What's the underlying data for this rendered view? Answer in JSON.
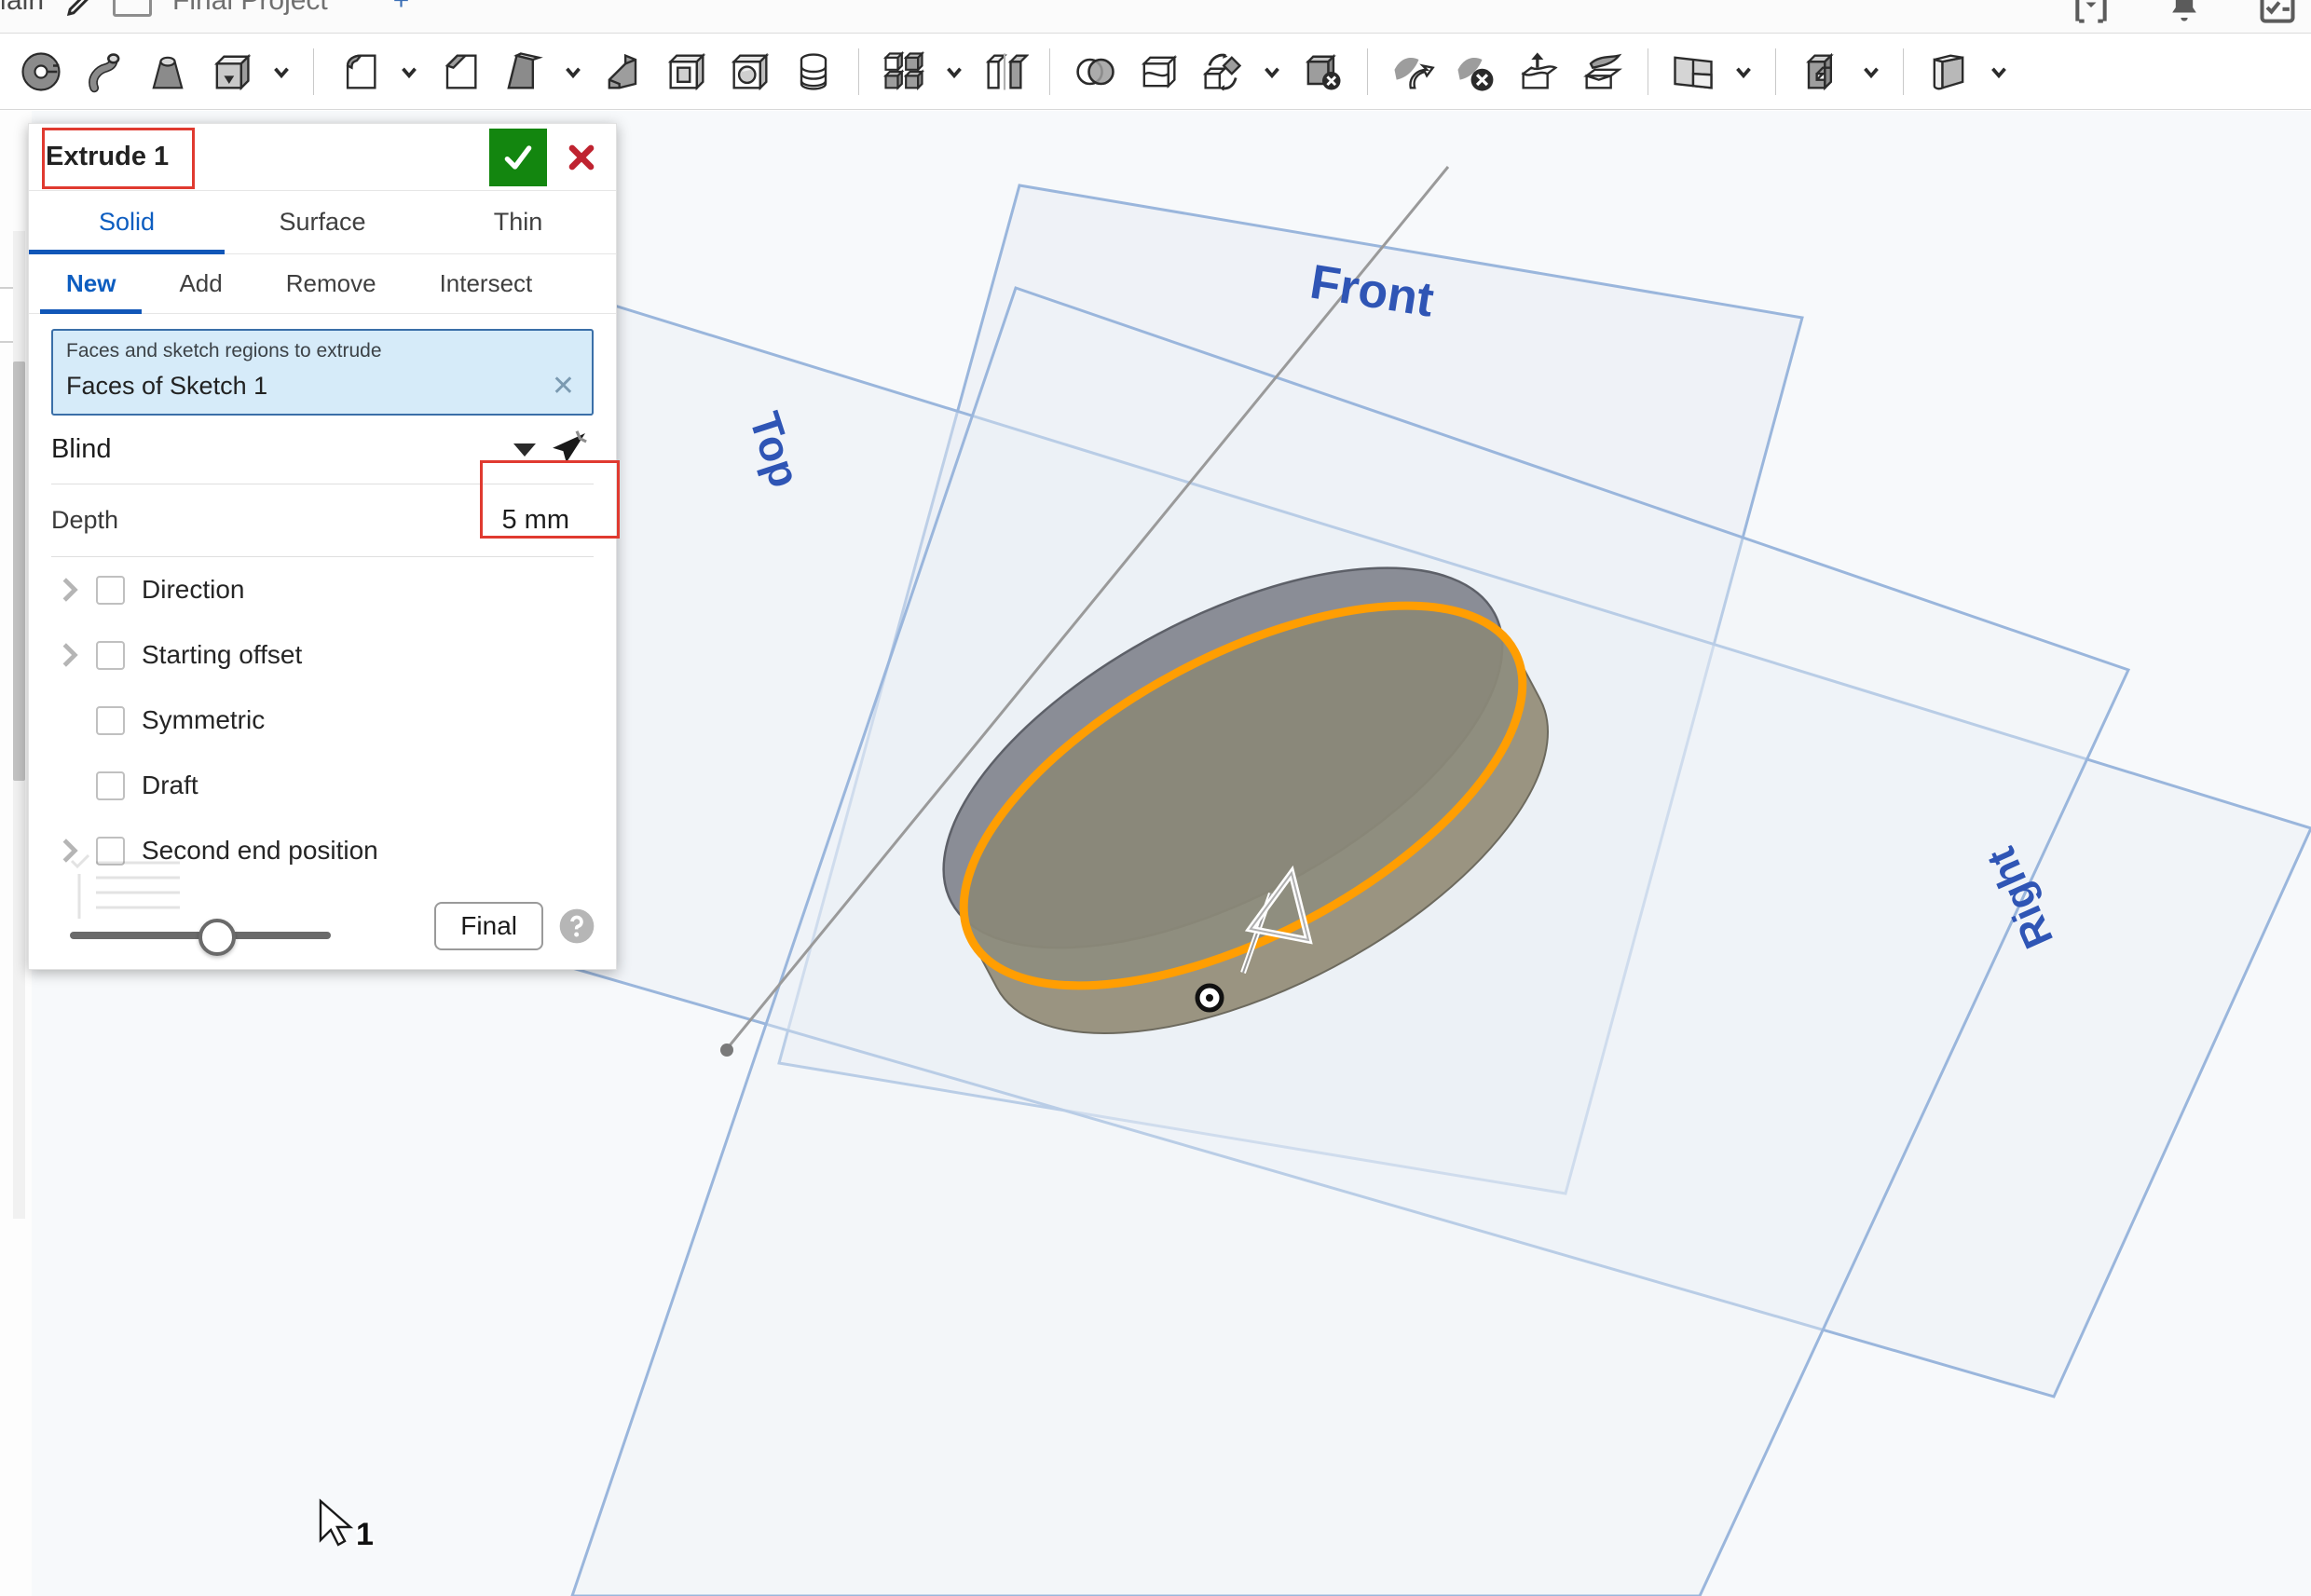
{
  "app": {
    "topbar": {
      "tab_main": "Main",
      "pencil_icon": "pencil-icon",
      "sheet_icon": "sheet-icon",
      "tab_project": "Final Project",
      "add_tab": "+",
      "icons": [
        "collapse-icon",
        "bell-icon",
        "checklist-icon"
      ]
    },
    "toolbar": {
      "items": [
        {
          "name": "sketch-icon",
          "caret": false
        },
        {
          "name": "sweep-icon",
          "caret": false
        },
        {
          "name": "loft-icon",
          "caret": false
        },
        {
          "name": "extrude-icon",
          "caret": true
        },
        {
          "sep": true
        },
        {
          "name": "fillet-icon",
          "caret": true
        },
        {
          "name": "chamfer-icon",
          "caret": false
        },
        {
          "name": "draft-icon",
          "caret": true
        },
        {
          "name": "rib-icon",
          "caret": false
        },
        {
          "name": "shell-icon",
          "caret": false
        },
        {
          "name": "hole-icon",
          "caret": false
        },
        {
          "name": "revolve-icon",
          "caret": false
        },
        {
          "sep": true
        },
        {
          "name": "linear-pattern-icon",
          "caret": true
        },
        {
          "name": "mirror-icon",
          "caret": false
        },
        {
          "sep": true
        },
        {
          "name": "boolean-icon",
          "caret": false
        },
        {
          "name": "split-icon",
          "caret": false
        },
        {
          "name": "transform-icon",
          "caret": true
        },
        {
          "name": "delete-part-icon",
          "caret": false
        },
        {
          "sep": true
        },
        {
          "name": "move-face-icon",
          "caret": false
        },
        {
          "name": "delete-face-icon",
          "caret": false
        },
        {
          "name": "replace-face-icon",
          "caret": false
        },
        {
          "name": "thicken-icon",
          "caret": false
        },
        {
          "sep": true
        },
        {
          "name": "plane-icon",
          "caret": true
        },
        {
          "sep": true
        },
        {
          "name": "sheet-metal-icon",
          "caret": true
        },
        {
          "sep": true
        },
        {
          "name": "flange-icon",
          "caret": true
        }
      ]
    },
    "dialog": {
      "title": "Extrude 1",
      "confirm_icon": "check-icon",
      "cancel_icon": "x-icon",
      "tabs": [
        {
          "label": "Solid",
          "active": true
        },
        {
          "label": "Surface",
          "active": false
        },
        {
          "label": "Thin",
          "active": false
        }
      ],
      "subtabs": [
        {
          "label": "New",
          "active": true
        },
        {
          "label": "Add",
          "active": false
        },
        {
          "label": "Remove",
          "active": false
        },
        {
          "label": "Intersect",
          "active": false
        }
      ],
      "selection": {
        "caption": "Faces and sketch regions to extrude",
        "value": "Faces of Sketch 1",
        "clear_icon": "close-icon"
      },
      "end_type": {
        "value": "Blind",
        "dropdown_icon": "chevron-down-icon",
        "flip_icon": "flip-direction-icon"
      },
      "depth": {
        "label": "Depth",
        "value": "5 mm"
      },
      "options": [
        {
          "label": "Direction",
          "checked": false,
          "expandable": true
        },
        {
          "label": "Starting offset",
          "checked": false,
          "expandable": true
        },
        {
          "label": "Symmetric",
          "checked": false,
          "expandable": false
        },
        {
          "label": "Draft",
          "checked": false,
          "expandable": false
        },
        {
          "label": "Second end position",
          "checked": false,
          "expandable": true
        }
      ],
      "footer": {
        "rollback_label": "rollback-slider",
        "final_button": "Final",
        "help_icon": "help-icon"
      },
      "highlights": {
        "title_box_color": "#e03a30",
        "depth_box_color": "#e03a30"
      }
    },
    "viewport": {
      "background": "#f7f9fb",
      "planes": [
        {
          "label": "Front"
        },
        {
          "label": "Top"
        },
        {
          "label": "Right"
        }
      ],
      "part": {
        "name": "extruded-disc",
        "top_face_color": "#8e9099",
        "side_face_color": "#9a9482",
        "highlight_edge_color": "#ff9e02"
      },
      "direction_arrow": "extrude-direction-arrow",
      "origin_marker": "origin-point"
    },
    "cursor": {
      "icon": "mouse-pointer",
      "badge": "1"
    }
  }
}
